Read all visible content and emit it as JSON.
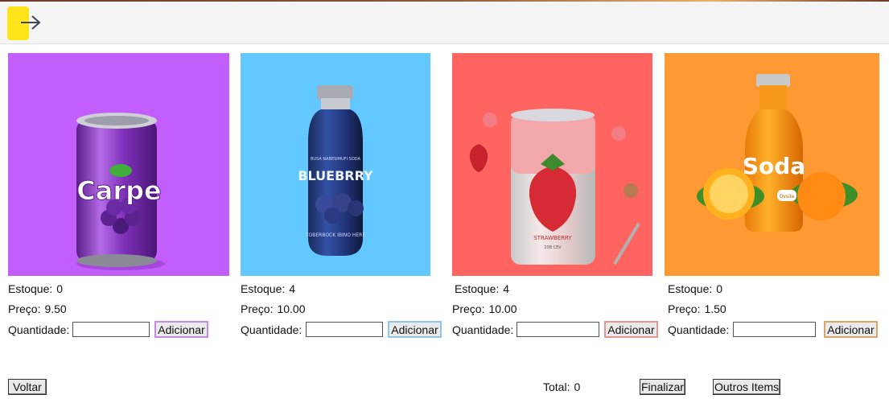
{
  "products": [
    {
      "title": "Carpe",
      "stock_label": "Estoque:",
      "stock": "0",
      "price_label": "Preço:",
      "price": "9.50",
      "qty_label": "Quantidade:",
      "qty_value": "",
      "add_label": "Adicionar",
      "bg": "#c25efc",
      "accent": "#c58be0"
    },
    {
      "title": "BLUEBRRY",
      "subtitle": "TOBERBOCK IBINO HERE",
      "top_text": "BUSA NABESIMUFI SODA",
      "stock_label": "Estoque:",
      "stock": "4",
      "price_label": "Preço:",
      "price": "10.00",
      "qty_label": "Quantidade:",
      "qty_value": "",
      "add_label": "Adicionar",
      "bg": "#63c8ff",
      "accent": "#8ec6e8"
    },
    {
      "title": "STRAWBERRY",
      "subtitle": "20B CEV",
      "stock_label": "Estoque:",
      "stock": "4",
      "price_label": "Preço:",
      "price": "10.00",
      "qty_label": "Quantidade:",
      "qty_value": "",
      "add_label": "Adicionar",
      "bg": "#ff6461",
      "accent": "#e49494"
    },
    {
      "title": "Soda",
      "badge": "Ovsile",
      "stock_label": "Estoque:",
      "stock": "0",
      "price_label": "Preço:",
      "price": "1.50",
      "qty_label": "Quantidade:",
      "qty_value": "",
      "add_label": "Adicionar",
      "bg": "#ff9933",
      "accent": "#d9a46a"
    }
  ],
  "footer": {
    "back_label": "Voltar",
    "total_label": "Total:",
    "total_value": "0",
    "finish_label": "Finalizar",
    "others_label": "Outros Items"
  }
}
